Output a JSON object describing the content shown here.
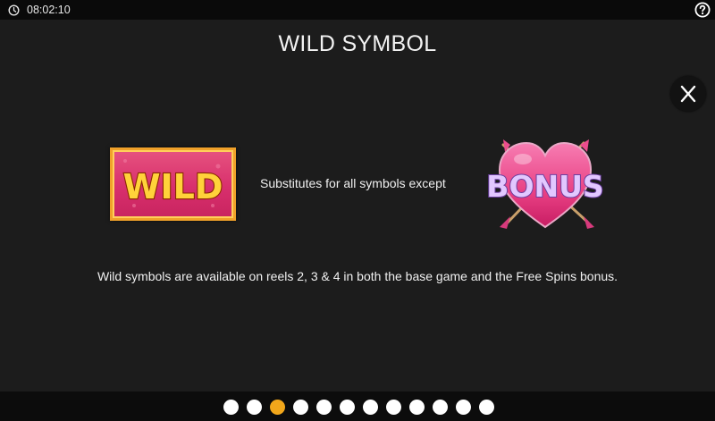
{
  "status": {
    "time": "08:02:10",
    "clock_icon": "clock-icon",
    "help_icon": "help-icon"
  },
  "page": {
    "title": "WILD SYMBOL",
    "close_label": "X"
  },
  "symbols": {
    "wild_label": "WILD",
    "substitutes_text": "Substitutes for all symbols except",
    "bonus_label": "BONUS"
  },
  "description": "Wild symbols are available on reels 2, 3 & 4 in both the base game and the Free Spins bonus.",
  "pagination": {
    "total": 12,
    "active_index": 2
  },
  "colors": {
    "background": "#1c1c1c",
    "active_dot": "#f2a71b",
    "inactive_dot": "#ffffff",
    "wild_pink": "#d82f6d",
    "wild_gold": "#f0a12a",
    "heart_pink": "#ec4d8e",
    "bonus_lilac": "#d9b8ff"
  }
}
